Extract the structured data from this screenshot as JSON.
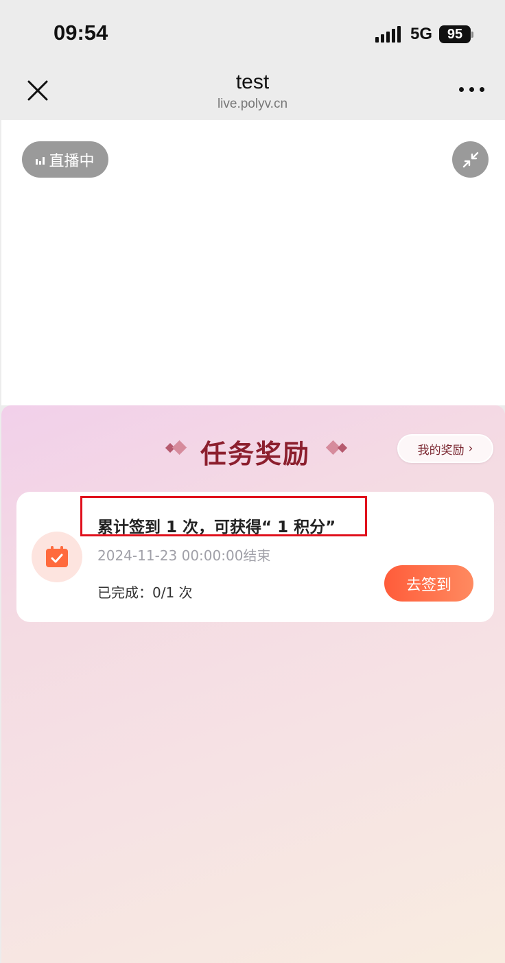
{
  "status_bar": {
    "time": "09:54",
    "network": "5G",
    "battery": "95"
  },
  "title_bar": {
    "title": "test",
    "url": "live.polyv.cn"
  },
  "player": {
    "live_label": "直播中"
  },
  "panel": {
    "title": "任务奖励",
    "my_rewards_label": "我的奖励",
    "task": {
      "title": "累计签到 1 次，可获得“ 1 积分”",
      "deadline": "2024-11-23 00:00:00结束",
      "progress": "已完成：0/1 次",
      "button_label": "去签到"
    }
  },
  "colors": {
    "accent": "#ff5c3a",
    "panel_title": "#8c1f2e",
    "highlight": "#e0101c"
  }
}
